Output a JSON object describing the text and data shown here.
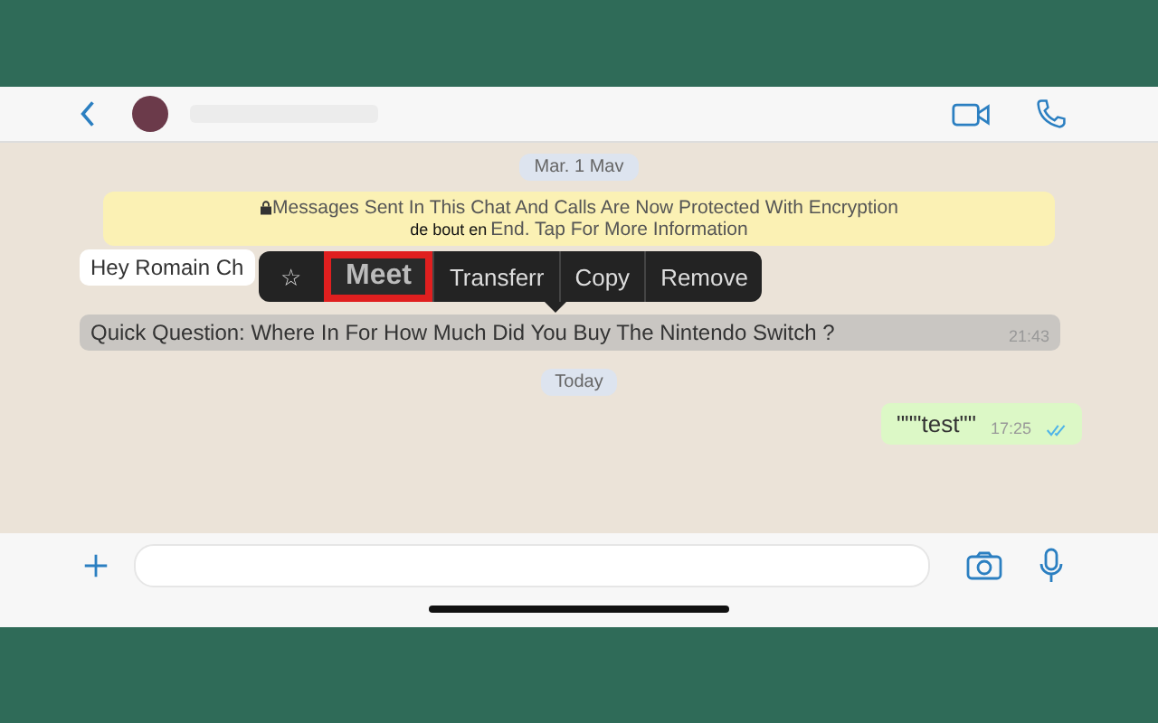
{
  "date_chip": "Mar. 1 Mav",
  "encryption_notice": {
    "line_1": "Messages Sent In This Chat And Calls Are Now Protected With Encryption",
    "line_2_prefix": "de bout en",
    "line_2": "End. Tap For More Information"
  },
  "context_menu": [
    {
      "kind": "star",
      "label": "☆",
      "selected": false
    },
    {
      "kind": "text",
      "label": "Meet",
      "selected": true
    },
    {
      "kind": "text",
      "label": "Transferr",
      "selected": false
    },
    {
      "kind": "text",
      "label": "Copy",
      "selected": false
    },
    {
      "kind": "text",
      "label": "Remove",
      "selected": false
    }
  ],
  "messages": [
    {
      "kind": "incoming",
      "text": "Hey Romain Ch",
      "selected": false
    },
    {
      "kind": "incoming",
      "text": "Quick Question: Where In For How Much Did You Buy The Nintendo Switch ?",
      "time": "21:43",
      "selected": true
    }
  ],
  "today_chip": "Today",
  "outgoing": [
    {
      "text": "\"\"\"test\"\"",
      "time": "17:25",
      "read": true
    }
  ]
}
